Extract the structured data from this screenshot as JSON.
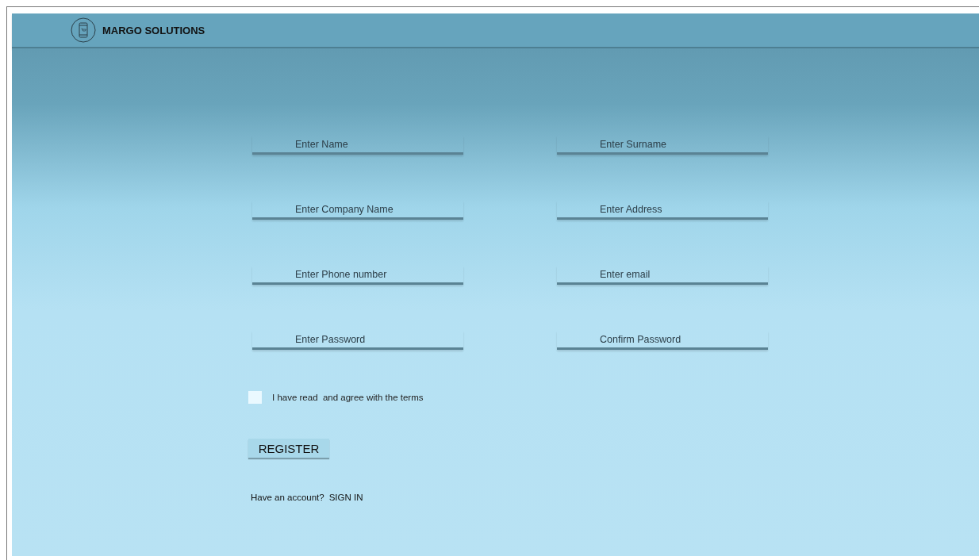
{
  "header": {
    "brand": "MARGO SOLUTIONS"
  },
  "fields": [
    {
      "placeholder": "Enter Name"
    },
    {
      "placeholder": "Enter Surname"
    },
    {
      "placeholder": "Enter Company Name"
    },
    {
      "placeholder": "Enter Address"
    },
    {
      "placeholder": "Enter Phone number"
    },
    {
      "placeholder": "Enter email"
    },
    {
      "placeholder": "Enter Password"
    },
    {
      "placeholder": "Confirm Password"
    }
  ],
  "terms": {
    "label": "I have read  and agree with the terms",
    "checked": false
  },
  "register_button": "REGISTER",
  "signin": {
    "prompt": "Have an account?",
    "link": "SIGN IN"
  }
}
